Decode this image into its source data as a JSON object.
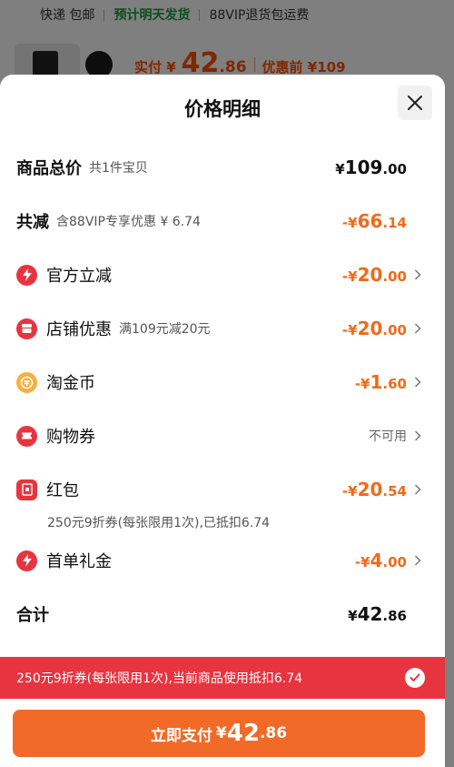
{
  "background": {
    "shipping": "快递 包邮",
    "delivery": "预计明天发货",
    "vip_note": "88VIP退货包运费",
    "paid_label": "实付 ¥",
    "paid_int": "42",
    "paid_dec": ".86",
    "before_label": "优惠前 ¥109"
  },
  "sheet": {
    "title": "价格明细",
    "rows": {
      "total": {
        "label": "商品总价",
        "sub": "共1件宝贝",
        "cur": "¥",
        "int": "109",
        "dec": ".00"
      },
      "reduction": {
        "label": "共减",
        "sub": "含88VIP专享优惠 ¥ 6.74",
        "cur": "-¥",
        "int": "66",
        "dec": ".14"
      },
      "official": {
        "label": "官方立减",
        "cur": "-¥",
        "int": "20",
        "dec": ".00"
      },
      "shop": {
        "label": "店铺优惠",
        "sub": "满109元减20元",
        "cur": "-¥",
        "int": "20",
        "dec": ".00"
      },
      "coins": {
        "label": "淘金币",
        "cur": "-¥",
        "int": "1",
        "dec": ".60"
      },
      "voucher": {
        "label": "购物券",
        "status": "不可用"
      },
      "redpacket": {
        "label": "红包",
        "cur": "-¥",
        "int": "20",
        "dec": ".54",
        "note": "250元9折券(每张限用1次),已抵扣6.74"
      },
      "first_order": {
        "label": "首单礼金",
        "cur": "-¥",
        "int": "4",
        "dec": ".00"
      },
      "sum": {
        "label": "合计",
        "cur": "¥",
        "int": "42",
        "dec": ".86"
      }
    },
    "banner": "250元9折券(每张限用1次),当前商品使用抵扣6.74",
    "pay": {
      "label": "立即支付",
      "cur": "¥",
      "int": "42",
      "dec": ".86"
    }
  },
  "colors": {
    "accent": "#f06a1a",
    "red": "#e8343f",
    "button": "#f26a27",
    "coin": "#f5b042"
  },
  "icons": {
    "official": "lightning-icon",
    "shop": "shop-icon",
    "coins": "coin-icon",
    "voucher": "ticket-icon",
    "redpacket": "red-envelope-icon",
    "first_order": "lightning-icon",
    "close": "close-icon",
    "check": "check-icon"
  }
}
